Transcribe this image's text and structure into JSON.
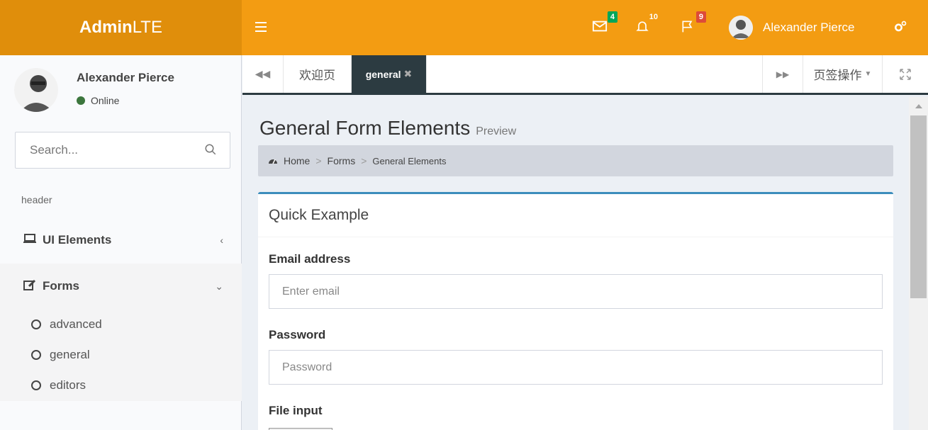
{
  "brand": {
    "bold": "Admin",
    "light": "LTE"
  },
  "topnav": {
    "mail_count": "4",
    "notif_count": "10",
    "flag_count": "9",
    "user_name": "Alexander Pierce"
  },
  "sidebar": {
    "user_name": "Alexander Pierce",
    "status": "Online",
    "search_placeholder": "Search...",
    "section_header": "header",
    "items": [
      {
        "label": "UI Elements"
      },
      {
        "label": "Forms"
      }
    ],
    "submenu": [
      "advanced",
      "general",
      "editors"
    ]
  },
  "tabs": {
    "welcome": "欢迎页",
    "general": "general",
    "actions": "页签操作"
  },
  "page": {
    "title": "General Form Elements",
    "subtitle": "Preview",
    "breadcrumb": [
      "Home",
      "Forms",
      "General Elements"
    ]
  },
  "form": {
    "box_title": "Quick Example",
    "email_label": "Email address",
    "email_placeholder": "Enter email",
    "password_label": "Password",
    "password_placeholder": "Password",
    "file_label": "File input"
  },
  "colors": {
    "header": "#f39c12",
    "tab_active": "#2c3b41",
    "box_top": "#3c8dbc"
  }
}
